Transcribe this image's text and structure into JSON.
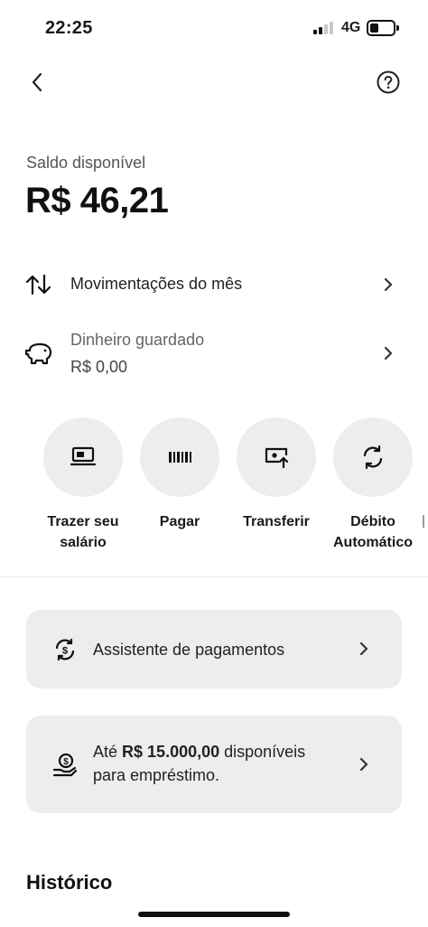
{
  "status_bar": {
    "time": "22:25",
    "network": "4G"
  },
  "header": {
    "back_icon": "chevron-left-icon",
    "help_icon": "question-circle-icon"
  },
  "balance": {
    "label": "Saldo disponível",
    "value": "R$ 46,21"
  },
  "movements": {
    "label": "Movimentações do mês",
    "icon": "arrows-up-down-icon"
  },
  "savings": {
    "label": "Dinheiro guardado",
    "value": "R$ 0,00",
    "icon": "piggy-bank-icon"
  },
  "actions": [
    {
      "label": "Trazer seu\nsalário",
      "icon": "bring-salary-icon"
    },
    {
      "label": "Pagar",
      "icon": "barcode-icon"
    },
    {
      "label": "Transferir",
      "icon": "transfer-money-icon"
    },
    {
      "label": "Débito\nAutomático",
      "icon": "refresh-icon"
    }
  ],
  "payment_assistant": {
    "label": "Assistente de pagamentos",
    "icon": "dollar-cycle-icon"
  },
  "loan": {
    "prefix": "Até ",
    "amount": "R$ 15.000,00",
    "suffix": " disponíveis",
    "line2": "para empréstimo.",
    "icon": "hand-money-icon"
  },
  "history": {
    "title": "Histórico"
  },
  "colors": {
    "card_bg": "#ededed",
    "text": "#1a1a1a",
    "muted": "#666666"
  }
}
